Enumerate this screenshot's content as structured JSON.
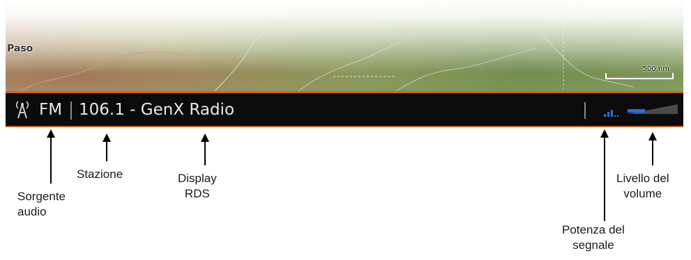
{
  "map": {
    "label": "Paso",
    "scale": "500 nm"
  },
  "status_bar": {
    "source": "FM",
    "station": "106.1 - GenX Radio",
    "signal_strength": 0.5,
    "volume_level": 0.35,
    "accent_color": "#d3631b",
    "level_color": "#2a6fdb"
  },
  "annotations": {
    "source": [
      "Sorgente",
      "audio"
    ],
    "station": "Stazione",
    "rds": [
      "Display",
      "RDS"
    ],
    "signal": [
      "Potenza del",
      "segnale"
    ],
    "volume": [
      "Livello del",
      "volume"
    ]
  }
}
